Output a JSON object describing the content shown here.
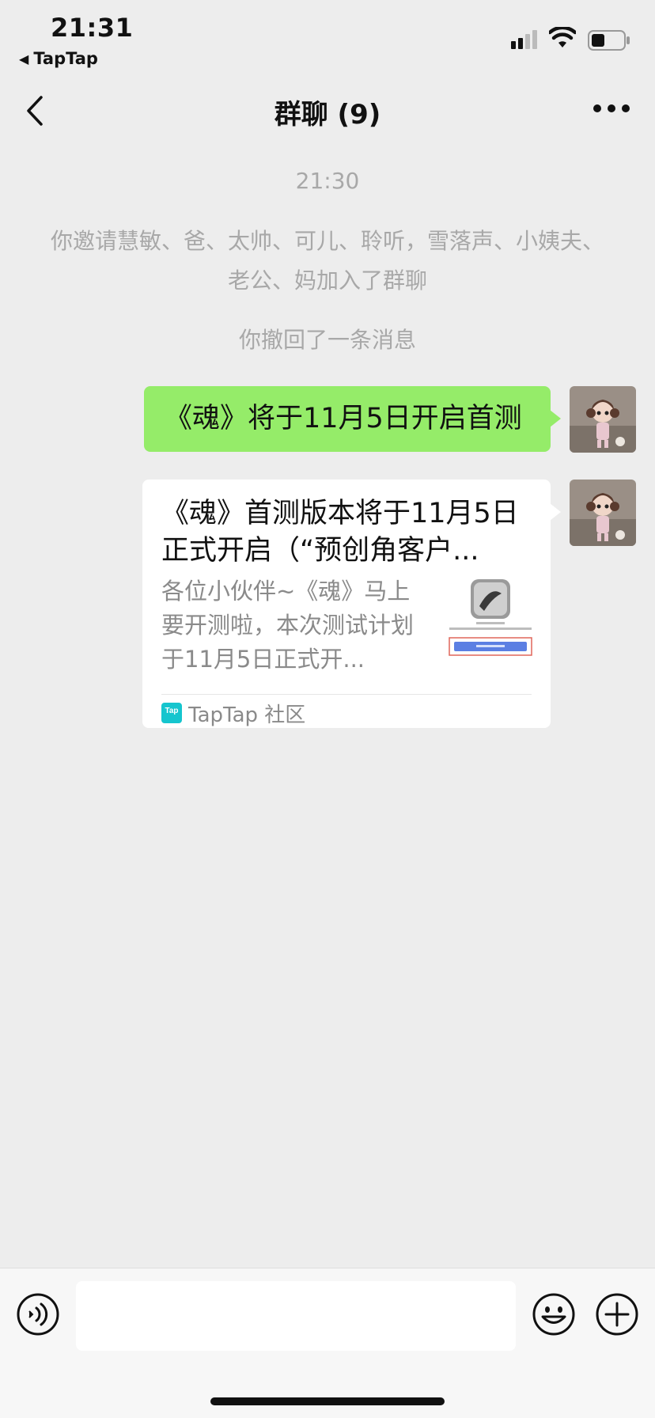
{
  "status_bar": {
    "time": "21:31",
    "back_app": "TapTap"
  },
  "nav": {
    "title": "群聊 (9)"
  },
  "chat": {
    "timestamp": "21:30",
    "invite_notice": "你邀请慧敏、爸、太帅、可儿、聆听，雪落声、小姨夫、老公、妈加入了群聊",
    "recall_notice": "你撤回了一条消息",
    "message_text": "《魂》将于11月5日开启首测",
    "card": {
      "title": "《魂》首测版本将于11月5日正式开启（“预创角客户...",
      "description": "各位小伙伴~《魂》马上要开测啦，本次测试计划于11月5日正式开...",
      "source": "TapTap 社区",
      "source_logo_text": "Tap"
    }
  },
  "colors": {
    "background": "#ededed",
    "self_bubble": "#95ec69",
    "system_text": "#a8a8a8",
    "input_bar": "#f7f7f7"
  },
  "icons": {
    "back": "chevron-left-icon",
    "more": "more-dots-icon",
    "voice": "voice-icon",
    "emoji": "emoji-icon",
    "plus": "plus-icon"
  }
}
